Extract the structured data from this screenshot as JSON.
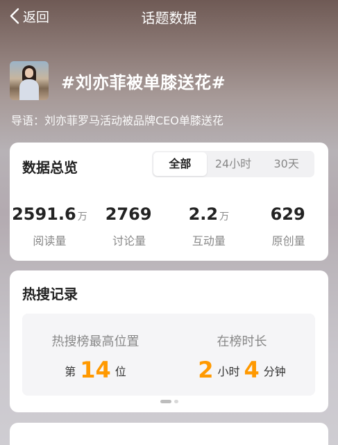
{
  "nav": {
    "back_label": "返回",
    "title": "话题数据"
  },
  "topic": {
    "name": "#刘亦菲被单膝送花#",
    "intro": "导语：刘亦菲罗马活动被品牌CEO单膝送花"
  },
  "overview": {
    "title": "数据总览",
    "tabs": [
      {
        "label": "全部",
        "active": true
      },
      {
        "label": "24小时",
        "active": false
      },
      {
        "label": "30天",
        "active": false
      }
    ],
    "stats": [
      {
        "value": "2591.6",
        "unit": "万",
        "label": "阅读量"
      },
      {
        "value": "2769",
        "unit": "",
        "label": "讨论量"
      },
      {
        "value": "2.2",
        "unit": "万",
        "label": "互动量"
      },
      {
        "value": "629",
        "unit": "",
        "label": "原创量"
      }
    ]
  },
  "hot": {
    "title": "热搜记录",
    "peak_label": "热搜榜最高位置",
    "peak_prefix": "第",
    "peak_rank": "14",
    "peak_suffix": "位",
    "duration_label": "在榜时长",
    "hours": "2",
    "hours_unit": "小时",
    "minutes": "4",
    "minutes_unit": "分钟"
  },
  "colors": {
    "accent": "#ff9900",
    "card_bg": "#ffffff"
  }
}
